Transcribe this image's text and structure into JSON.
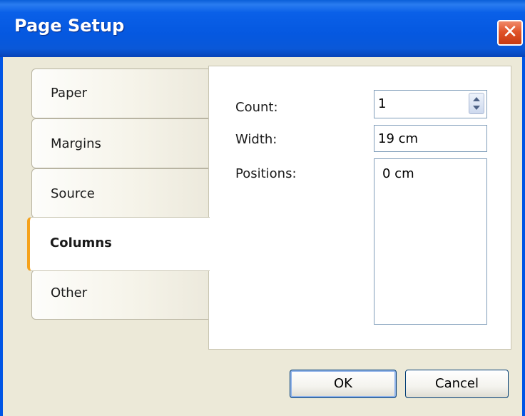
{
  "window": {
    "title": "Page Setup",
    "close_glyph": "✕"
  },
  "tabs": [
    {
      "label": "Paper",
      "active": false
    },
    {
      "label": "Margins",
      "active": false
    },
    {
      "label": "Source",
      "active": false
    },
    {
      "label": "Columns",
      "active": true
    },
    {
      "label": "Other",
      "active": false
    }
  ],
  "columns": {
    "count_label": "Count:",
    "count_value": "1",
    "width_label": "Width:",
    "width_value": "19 cm",
    "positions_label": "Positions:",
    "positions_items": [
      "0 cm"
    ]
  },
  "buttons": {
    "ok": "OK",
    "cancel": "Cancel"
  },
  "colors": {
    "title_bar": "#0055e5",
    "close_button": "#e0542a",
    "client_bg": "#ece9d8",
    "active_tab_accent": "#f5a21c",
    "field_border": "#7f9db9"
  }
}
